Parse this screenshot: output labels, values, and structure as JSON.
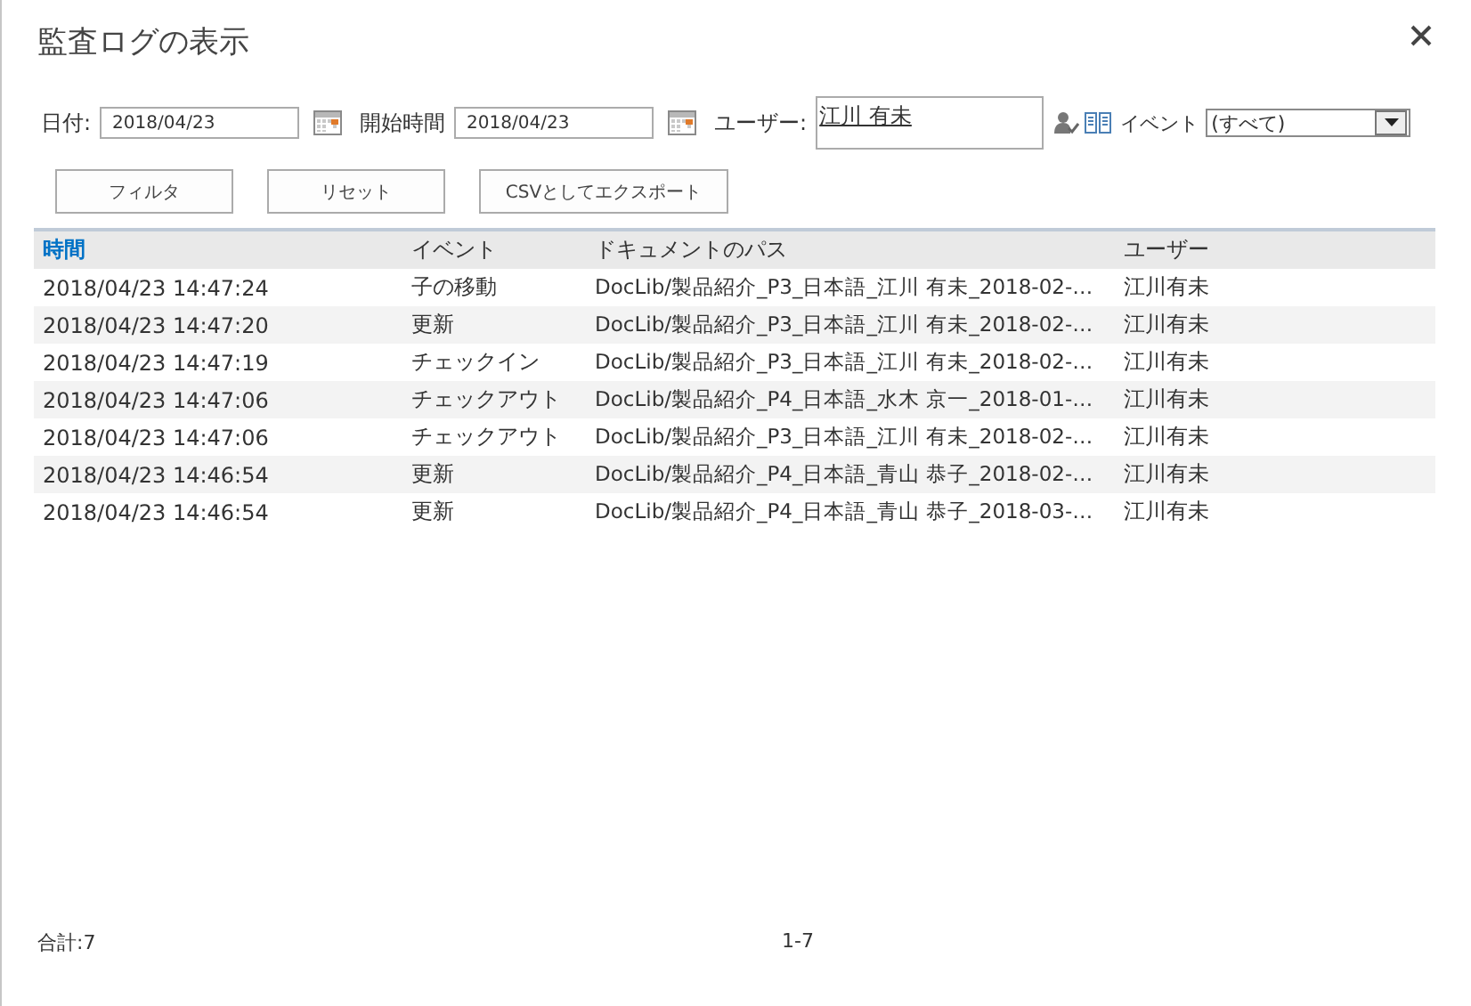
{
  "window": {
    "title": "監査ログの表示"
  },
  "filters": {
    "date_label": "日付:",
    "date_value": "2018/04/23",
    "start_label": "開始時間",
    "start_value": "2018/04/23",
    "user_label": "ユーザー:",
    "user_value": "江川 有未",
    "event_label": "イベント",
    "event_value": "(すべて)"
  },
  "buttons": [
    "フィルタ",
    "リセット",
    "CSVとしてエクスポート"
  ],
  "table": {
    "columns": [
      {
        "label": "時間",
        "sorted": true
      },
      {
        "label": "イベント",
        "sorted": false
      },
      {
        "label": "ドキュメントのパス",
        "sorted": false
      },
      {
        "label": "ユーザー",
        "sorted": false
      }
    ],
    "rows": [
      [
        "2018/04/23 14:47:24",
        "子の移動",
        "DocLib/製品紹介_P3_日本語_江川 有未_2018-02-…",
        "江川有未"
      ],
      [
        "2018/04/23 14:47:20",
        "更新",
        "DocLib/製品紹介_P3_日本語_江川 有未_2018-02-…",
        "江川有未"
      ],
      [
        "2018/04/23 14:47:19",
        "チェックイン",
        "DocLib/製品紹介_P3_日本語_江川 有未_2018-02-…",
        "江川有未"
      ],
      [
        "2018/04/23 14:47:06",
        "チェックアウト",
        "DocLib/製品紹介_P4_日本語_水木 京一_2018-01-…",
        "江川有未"
      ],
      [
        "2018/04/23 14:47:06",
        "チェックアウト",
        "DocLib/製品紹介_P3_日本語_江川 有未_2018-02-…",
        "江川有未"
      ],
      [
        "2018/04/23 14:46:54",
        "更新",
        "DocLib/製品紹介_P4_日本語_青山 恭子_2018-02-…",
        "江川有未"
      ],
      [
        "2018/04/23 14:46:54",
        "更新",
        "DocLib/製品紹介_P4_日本語_青山 恭子_2018-03-…",
        "江川有未"
      ]
    ]
  },
  "status_bar": {
    "total": "合計:7",
    "range": "1-7"
  }
}
